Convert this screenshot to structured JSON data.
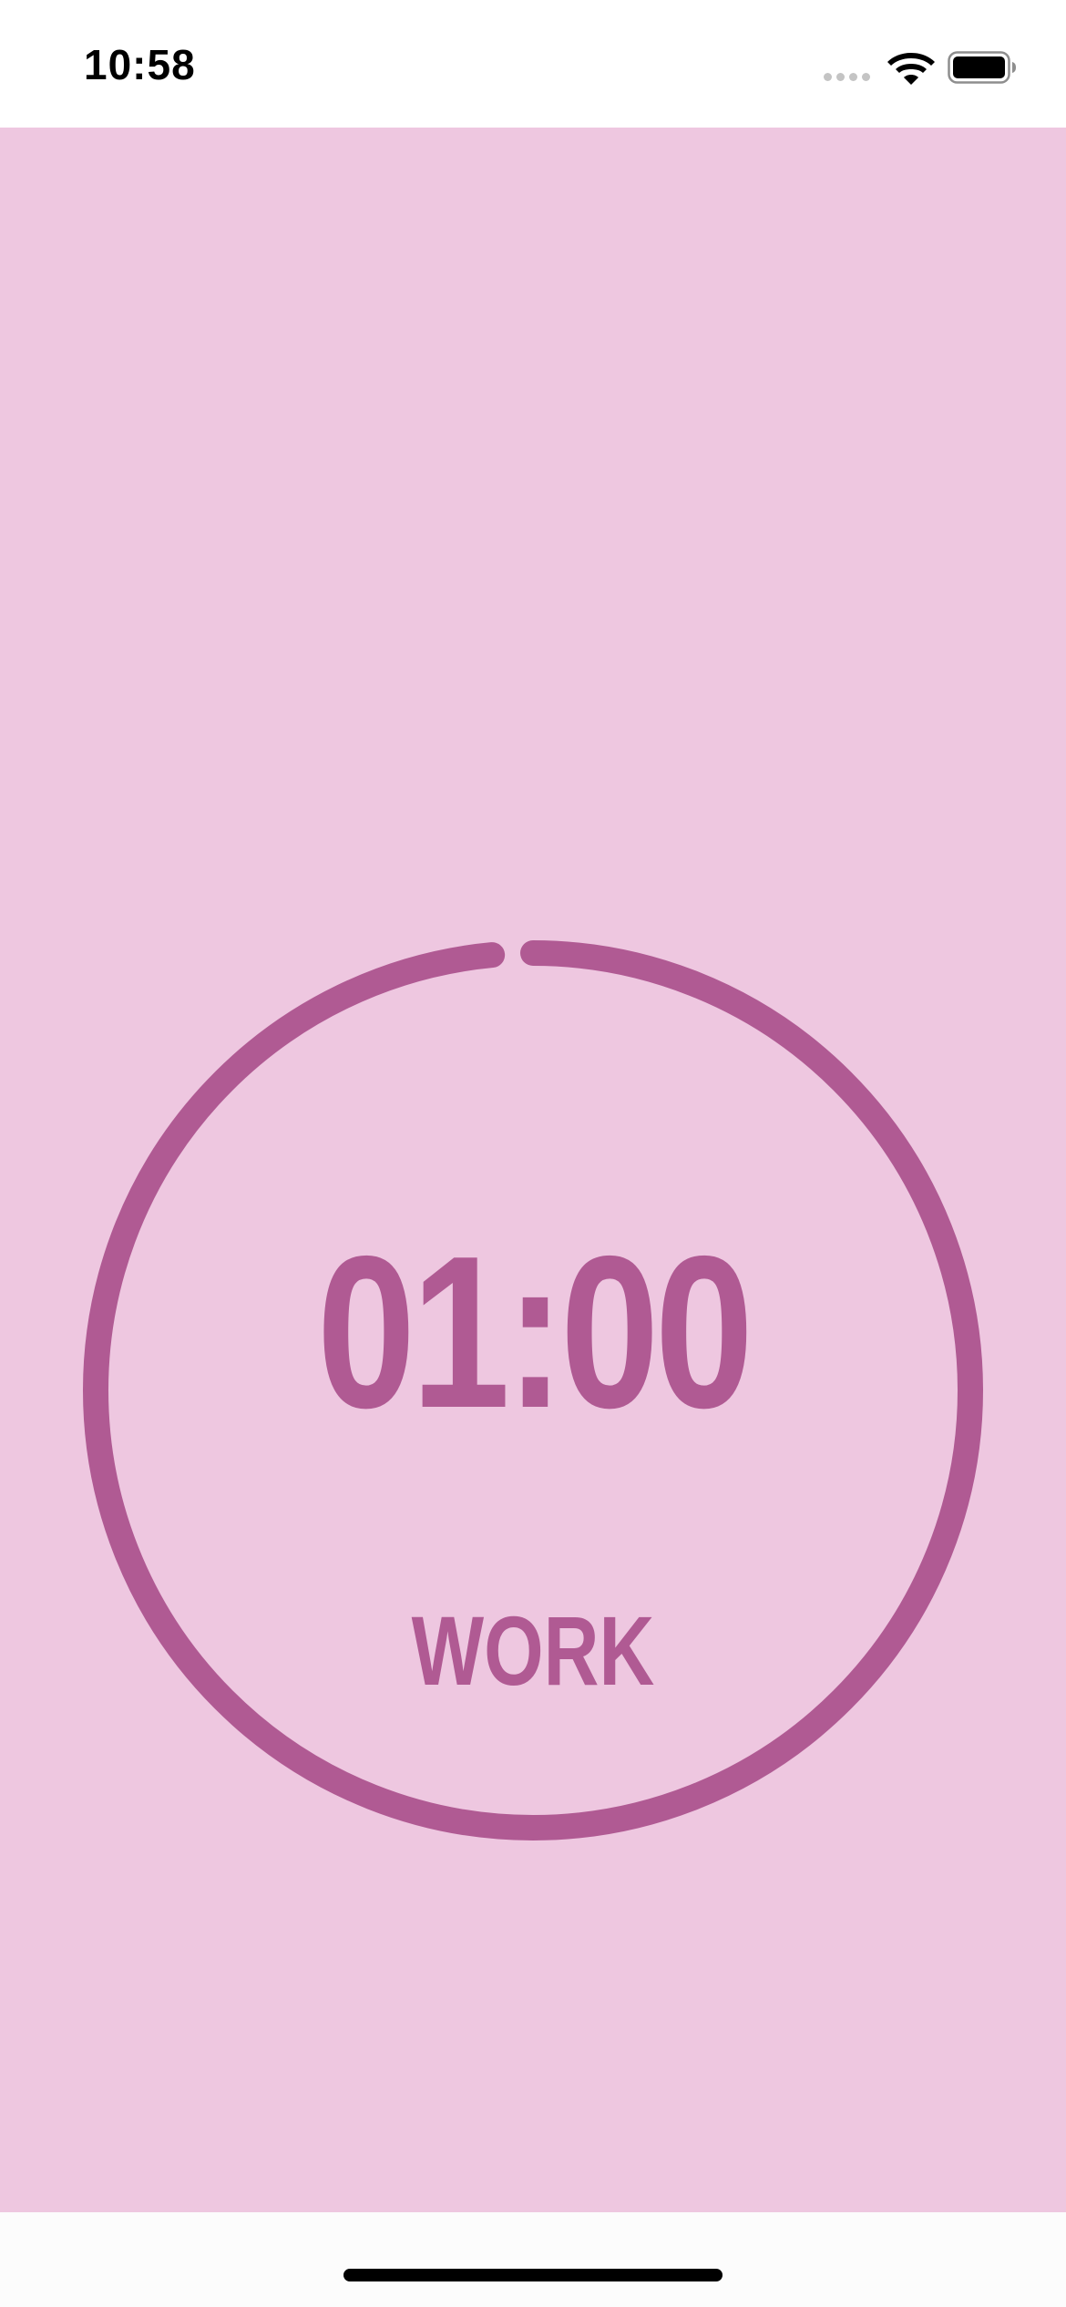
{
  "status_bar": {
    "time": "10:58",
    "wifi_icon": "wifi-icon",
    "battery_icon": "battery-full-icon"
  },
  "timer": {
    "time_display": "01:00",
    "phase_label": "WORK",
    "progress_fraction": 0.985
  },
  "colors": {
    "background": "#EEC7E0",
    "accent": "#B05A93",
    "status_bar_bg": "#FFFFFF"
  }
}
